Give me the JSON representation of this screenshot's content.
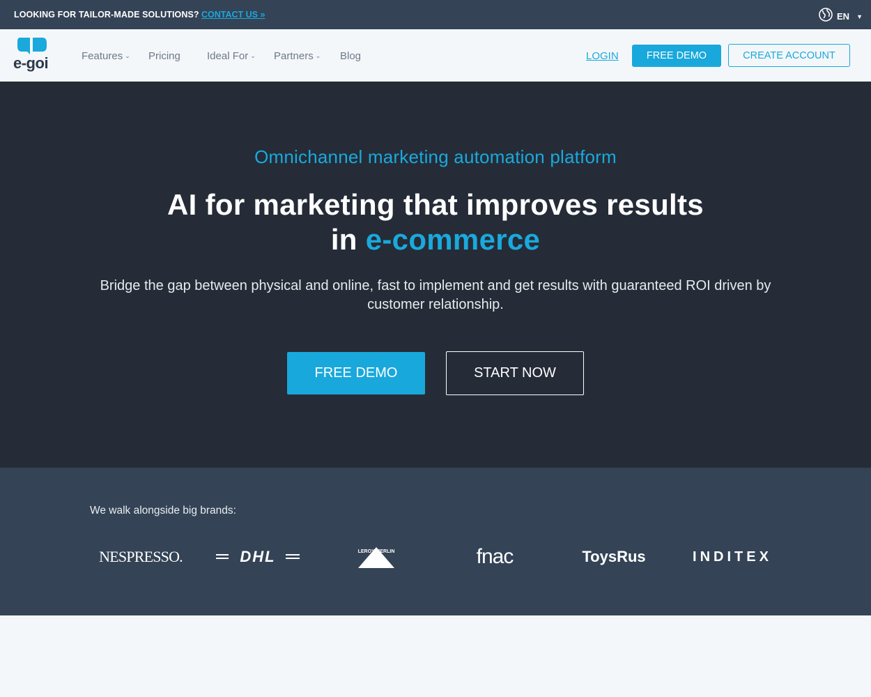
{
  "topbar": {
    "promo": "LOOKING FOR TAILOR-MADE SOLUTIONS?",
    "promo_link": "CONTACT US »",
    "language": "EN"
  },
  "nav": {
    "logo_text": "e-goi",
    "items": [
      {
        "label": "Features",
        "has_dropdown": true
      },
      {
        "label": "Pricing",
        "has_dropdown": false
      },
      {
        "label": "Ideal For",
        "has_dropdown": true
      },
      {
        "label": "Partners",
        "has_dropdown": true
      },
      {
        "label": "Blog",
        "has_dropdown": false
      }
    ],
    "login": "LOGIN",
    "free_demo": "FREE DEMO",
    "create_account": "CREATE ACCOUNT"
  },
  "hero": {
    "eyebrow": "Omnichannel marketing automation platform",
    "title_line1": "AI for marketing that improves results",
    "title_line2_prefix": "in ",
    "title_line2_accent": "e-commerce",
    "subtitle": "Bridge the gap between physical and online, fast to implement and get results with guaranteed ROI driven by customer relationship.",
    "primary_button": "FREE DEMO",
    "secondary_button": "START NOW"
  },
  "brands": {
    "label": "We walk alongside big brands:",
    "logos": [
      "NESPRESSO.",
      "DHL",
      "LEROY MERLIN",
      "fnac",
      "ToysRus",
      "INDITEX"
    ]
  },
  "colors": {
    "accent": "#19a8db",
    "topbar_bg": "#344356",
    "hero_bg": "#252c37",
    "page_bg": "#f4f7fa"
  }
}
